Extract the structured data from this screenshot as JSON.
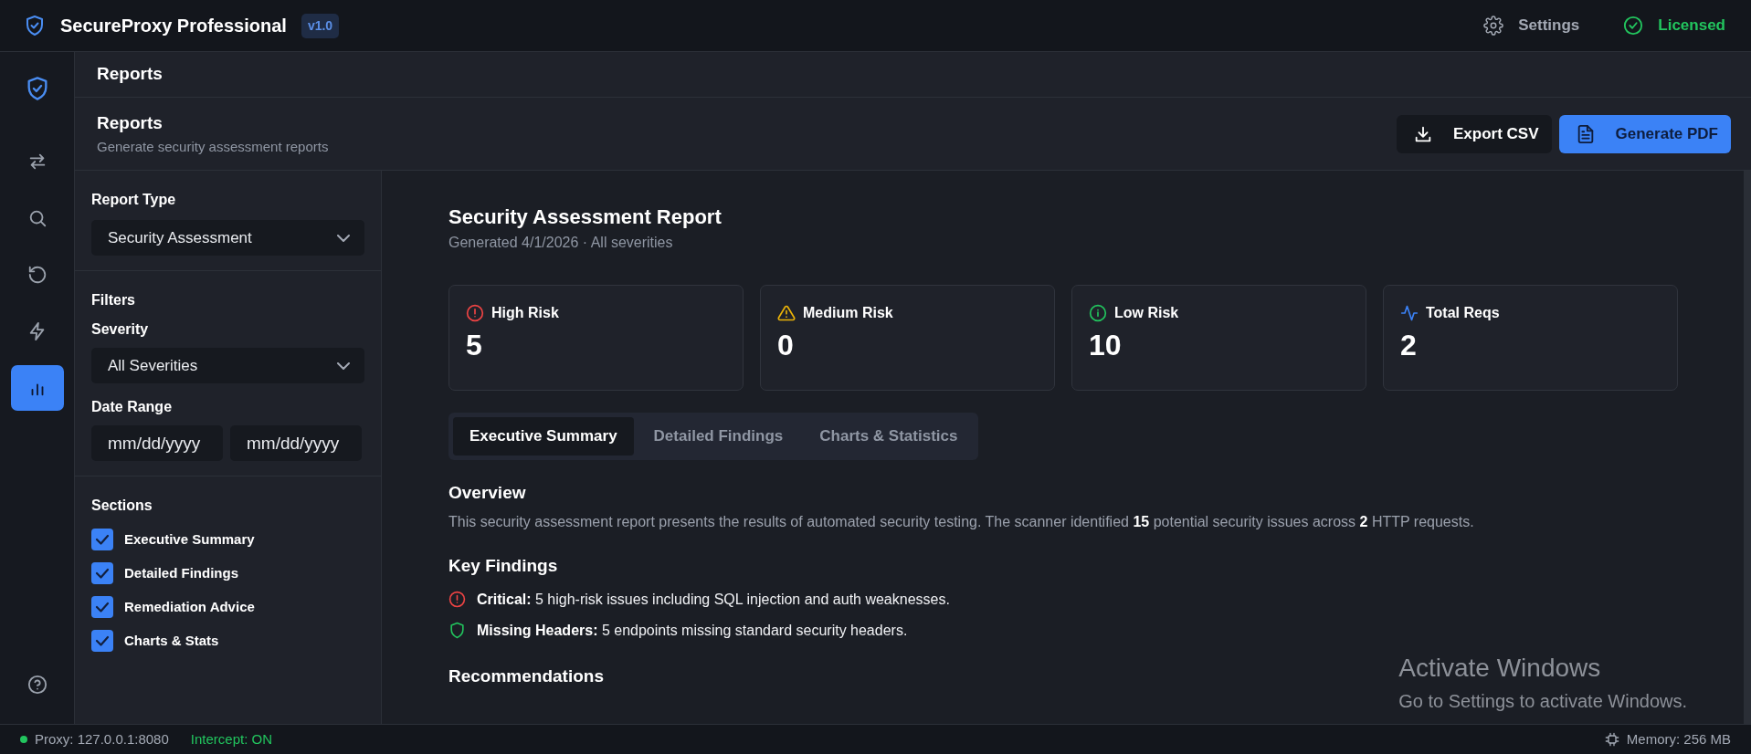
{
  "app": {
    "name": "SecureProxy Professional",
    "version": "v1.0",
    "settings": "Settings",
    "license": "Licensed"
  },
  "nav": [
    {
      "kind": "shield",
      "selected": false
    },
    {
      "kind": "arrows",
      "selected": false
    },
    {
      "kind": "search",
      "selected": false
    },
    {
      "kind": "history",
      "selected": false
    },
    {
      "kind": "bolt",
      "selected": false
    },
    {
      "kind": "chart",
      "selected": true
    }
  ],
  "help_icon": {
    "kind": "help"
  },
  "breadcrumb": "Reports",
  "header": {
    "title": "Reports",
    "subtitle": "Generate security assessment reports",
    "buttons": [
      {
        "kind": "export",
        "label": "Export CSV"
      },
      {
        "kind": "pdf",
        "label": "Generate PDF"
      }
    ]
  },
  "options": {
    "report_type_label": "Report Type",
    "report_type": "Security Assessment",
    "filters_label": "Filters",
    "severity_label": "Severity",
    "severity": "All Severities",
    "date_label": "Date Range",
    "date_from_placeholder": "mm/dd/yyyy",
    "date_to_placeholder": "mm/dd/yyyy",
    "sections_label": "Sections",
    "sections": [
      {
        "label": "Executive Summary",
        "checked": true
      },
      {
        "label": "Detailed Findings",
        "checked": true
      },
      {
        "label": "Remediation Advice",
        "checked": true
      },
      {
        "label": "Charts & Stats",
        "checked": true
      }
    ]
  },
  "report": {
    "title": "Security Assessment Report",
    "meta": "Generated 4/1/2026 · All severities",
    "stats": [
      {
        "kind": "high",
        "label": "High Risk",
        "value": "5"
      },
      {
        "kind": "medium",
        "label": "Medium Risk",
        "value": "0"
      },
      {
        "kind": "low",
        "label": "Low Risk",
        "value": "10"
      },
      {
        "kind": "total",
        "label": "Total Reqs",
        "value": "2"
      }
    ],
    "tabs": [
      {
        "label": "Executive Summary",
        "selected": true
      },
      {
        "label": "Detailed Findings",
        "selected": false
      },
      {
        "label": "Charts & Statistics",
        "selected": false
      }
    ],
    "overview_title": "Overview",
    "overview": "This security assessment report presents the results of automated security testing. The scanner identified **15** potential security issues across **2** HTTP requests.",
    "findings_title": "Key Findings",
    "findings": [
      {
        "kind": "critical",
        "text": "**Critical:** 5 high-risk issues including SQL injection and auth weaknesses."
      },
      {
        "kind": "headers",
        "text": "**Missing Headers:** 5 endpoints missing standard security headers."
      }
    ],
    "recommendations_title": "Recommendations"
  },
  "status_bar": {
    "proxy": "Proxy: 127.0.0.1:8080",
    "intercept": "Intercept: ON",
    "memory": "Memory: 256 MB"
  },
  "os_notice": {
    "title": "Activate Windows",
    "text": "Go to Settings to activate Windows."
  }
}
